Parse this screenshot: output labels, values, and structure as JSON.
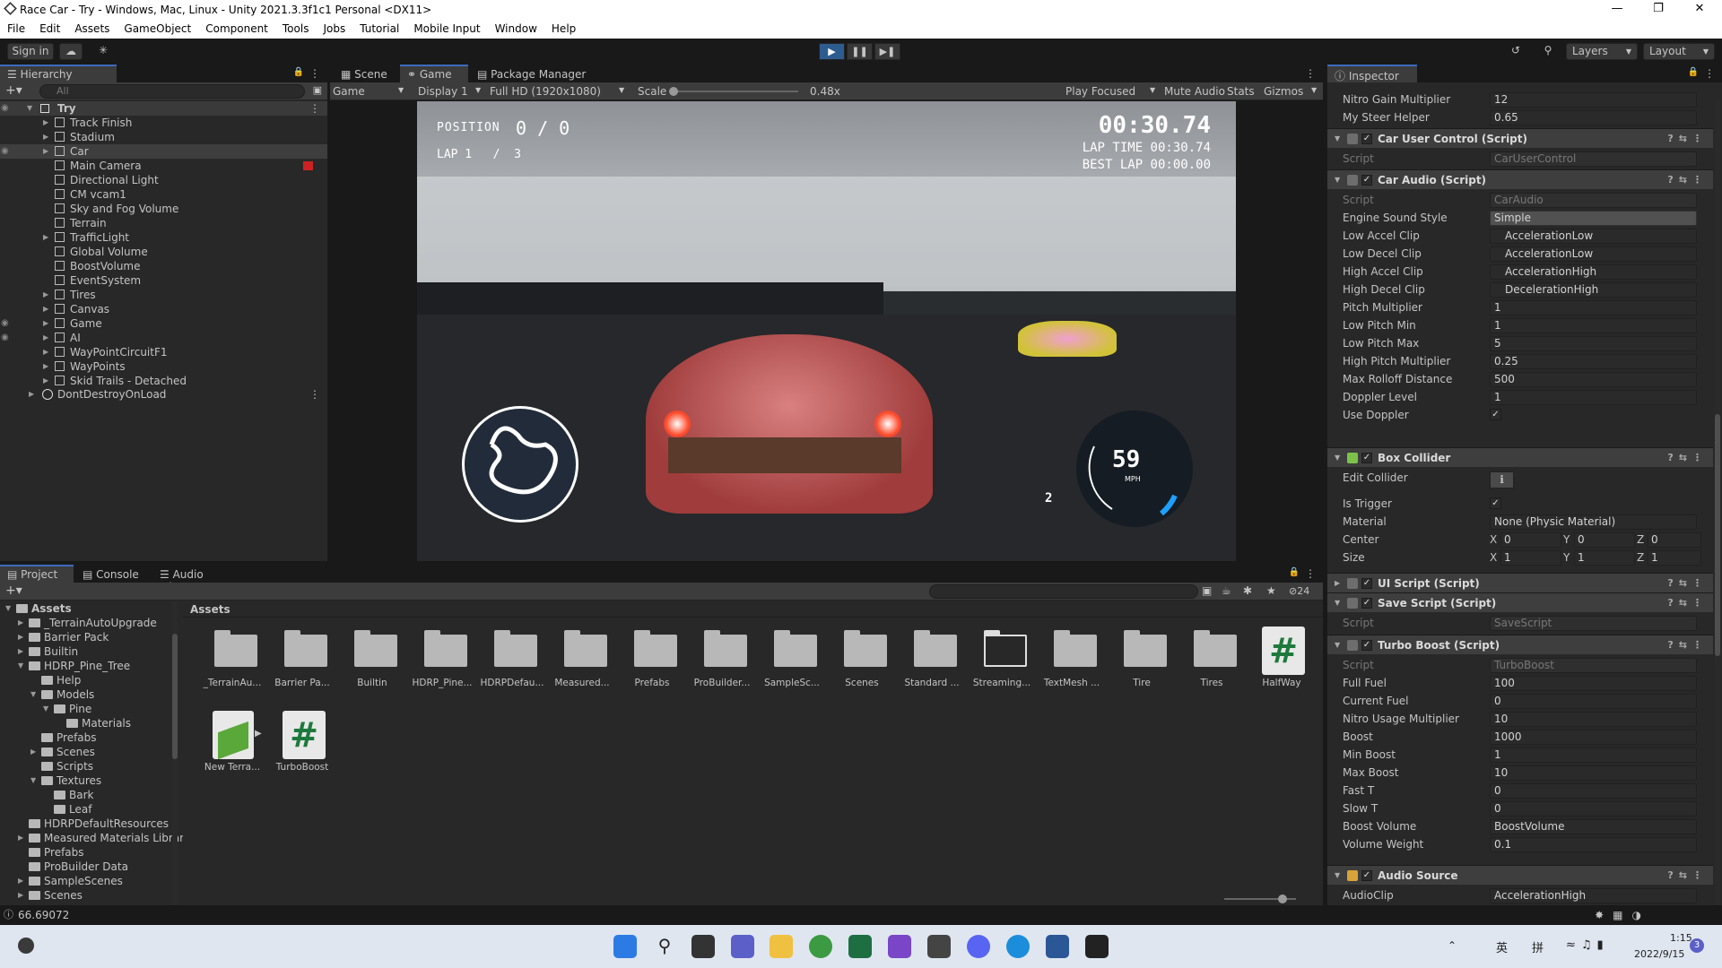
{
  "window": {
    "title": "Race Car - Try - Windows, Mac, Linux - Unity 2021.3.3f1c1 Personal <DX11>"
  },
  "menu": [
    "File",
    "Edit",
    "Assets",
    "GameObject",
    "Component",
    "Tools",
    "Jobs",
    "Tutorial",
    "Mobile Input",
    "Window",
    "Help"
  ],
  "toolbar": {
    "sign_in": "Sign in",
    "layers": "Layers",
    "layout": "Layout"
  },
  "hierarchy": {
    "tab": "Hierarchy",
    "search_placeholder": "All",
    "root": "Try",
    "items": [
      "Track Finish",
      "Stadium",
      "Car",
      "Main Camera",
      "Directional Light",
      "CM vcam1",
      "Sky and Fog Volume",
      "Terrain",
      "TrafficLight",
      "Global Volume",
      "BoostVolume",
      "EventSystem",
      "Tires",
      "Canvas",
      "Game",
      "AI",
      "WayPointCircuitF1",
      "WayPoints",
      "Skid Trails - Detached"
    ],
    "dont_destroy": "DontDestroyOnLoad"
  },
  "viewtabs": {
    "scene": "Scene",
    "game": "Game",
    "package_manager": "Package Manager"
  },
  "game_toolbar": {
    "mode": "Game",
    "display": "Display 1",
    "resolution": "Full HD (1920x1080)",
    "scale_label": "Scale",
    "scale_value": "0.48x",
    "play_focused": "Play Focused",
    "mute_audio": "Mute Audio",
    "stats": "Stats",
    "gizmos": "Gizmos"
  },
  "hud": {
    "position_label": "POSITION",
    "position": "0 / 0",
    "lap": "LAP 1   /  3",
    "timer": "00:30.74",
    "lap_time": "LAP TIME 00:30.74",
    "best_lap": "BEST LAP 00:00.00",
    "speed": "59",
    "speed_unit": "MPH",
    "gear": "2"
  },
  "project": {
    "tabs": [
      "Project",
      "Console",
      "Audio Mixer"
    ],
    "breadcrumb": "Assets",
    "badge_count": "24",
    "tree": [
      {
        "label": "Assets",
        "depth": 0,
        "bold": true
      },
      {
        "label": "_TerrainAutoUpgrade",
        "depth": 1
      },
      {
        "label": "Barrier Pack",
        "depth": 1
      },
      {
        "label": "Builtin",
        "depth": 1
      },
      {
        "label": "HDRP_Pine_Tree",
        "depth": 1
      },
      {
        "label": "Help",
        "depth": 2
      },
      {
        "label": "Models",
        "depth": 2
      },
      {
        "label": "Pine",
        "depth": 3
      },
      {
        "label": "Materials",
        "depth": 4
      },
      {
        "label": "Prefabs",
        "depth": 2
      },
      {
        "label": "Scenes",
        "depth": 2
      },
      {
        "label": "Scripts",
        "depth": 2
      },
      {
        "label": "Textures",
        "depth": 2
      },
      {
        "label": "Bark",
        "depth": 3
      },
      {
        "label": "Leaf",
        "depth": 3
      },
      {
        "label": "HDRPDefaultResources",
        "depth": 1
      },
      {
        "label": "Measured Materials Librar",
        "depth": 1
      },
      {
        "label": "Prefabs",
        "depth": 1
      },
      {
        "label": "ProBuilder Data",
        "depth": 1
      },
      {
        "label": "SampleScenes",
        "depth": 1
      },
      {
        "label": "Scenes",
        "depth": 1
      }
    ],
    "assets": [
      "_TerrainAu...",
      "Barrier Pa...",
      "Builtin",
      "HDRP_Pine...",
      "HDRPDefau...",
      "Measured...",
      "Prefabs",
      "ProBuilder...",
      "SampleSc...",
      "Scenes",
      "Standard ...",
      "Streaming...",
      "TextMesh ...",
      "Tire",
      "Tires",
      "HalfWay",
      "New Terra...",
      "TurboBoost"
    ]
  },
  "inspector": {
    "tab": "Inspector",
    "top_fields": [
      {
        "label": "Nitro Gain Multiplier",
        "value": "12"
      },
      {
        "label": "My Steer Helper",
        "value": "0.65"
      }
    ],
    "car_user_control": {
      "title": "Car User Control (Script)",
      "script": "CarUserControl"
    },
    "car_audio": {
      "title": "Car Audio (Script)",
      "script": "CarAudio",
      "fields": [
        {
          "label": "Engine Sound Style",
          "value": "Simple"
        },
        {
          "label": "Low Accel Clip",
          "value": "AccelerationLow"
        },
        {
          "label": "Low Decel Clip",
          "value": "AccelerationLow"
        },
        {
          "label": "High Accel Clip",
          "value": "AccelerationHigh"
        },
        {
          "label": "High Decel Clip",
          "value": "DecelerationHigh"
        },
        {
          "label": "Pitch Multiplier",
          "value": "1"
        },
        {
          "label": "Low Pitch Min",
          "value": "1"
        },
        {
          "label": "Low Pitch Max",
          "value": "5"
        },
        {
          "label": "High Pitch Multiplier",
          "value": "0.25"
        },
        {
          "label": "Max Rolloff Distance",
          "value": "500"
        },
        {
          "label": "Doppler Level",
          "value": "1"
        },
        {
          "label": "Use Doppler",
          "value": "✓"
        }
      ]
    },
    "box_collider": {
      "title": "Box Collider",
      "edit_collider": "Edit Collider",
      "is_trigger": "Is Trigger",
      "material_label": "Material",
      "material": "None (Physic Material)",
      "center_label": "Center",
      "center": [
        "0",
        "0",
        "0"
      ],
      "size_label": "Size",
      "size": [
        "1",
        "1",
        "1"
      ]
    },
    "ui_script": {
      "title": "UI Script (Script)"
    },
    "save_script": {
      "title": "Save Script (Script)",
      "script": "SaveScript"
    },
    "turbo_boost": {
      "title": "Turbo Boost (Script)",
      "script": "TurboBoost",
      "fields": [
        {
          "label": "Full Fuel",
          "value": "100"
        },
        {
          "label": "Current Fuel",
          "value": "0"
        },
        {
          "label": "Nitro Usage Multiplier",
          "value": "10"
        },
        {
          "label": "Boost",
          "value": "1000"
        },
        {
          "label": "Min Boost",
          "value": "1"
        },
        {
          "label": "Max Boost",
          "value": "10"
        },
        {
          "label": "Fast T",
          "value": "0"
        },
        {
          "label": "Slow T",
          "value": "0"
        },
        {
          "label": "Boost Volume",
          "value": "BoostVolume"
        },
        {
          "label": "Volume Weight",
          "value": "0.1"
        }
      ]
    },
    "audio_source": {
      "title": "Audio Source",
      "clip_label": "AudioClip",
      "clip": "AccelerationHigh"
    }
  },
  "status": {
    "fps": "66.69072"
  },
  "taskbar": {
    "time": "1:15",
    "date": "2022/9/15",
    "ime": "英",
    "ime2": "拼",
    "notif": "3"
  }
}
